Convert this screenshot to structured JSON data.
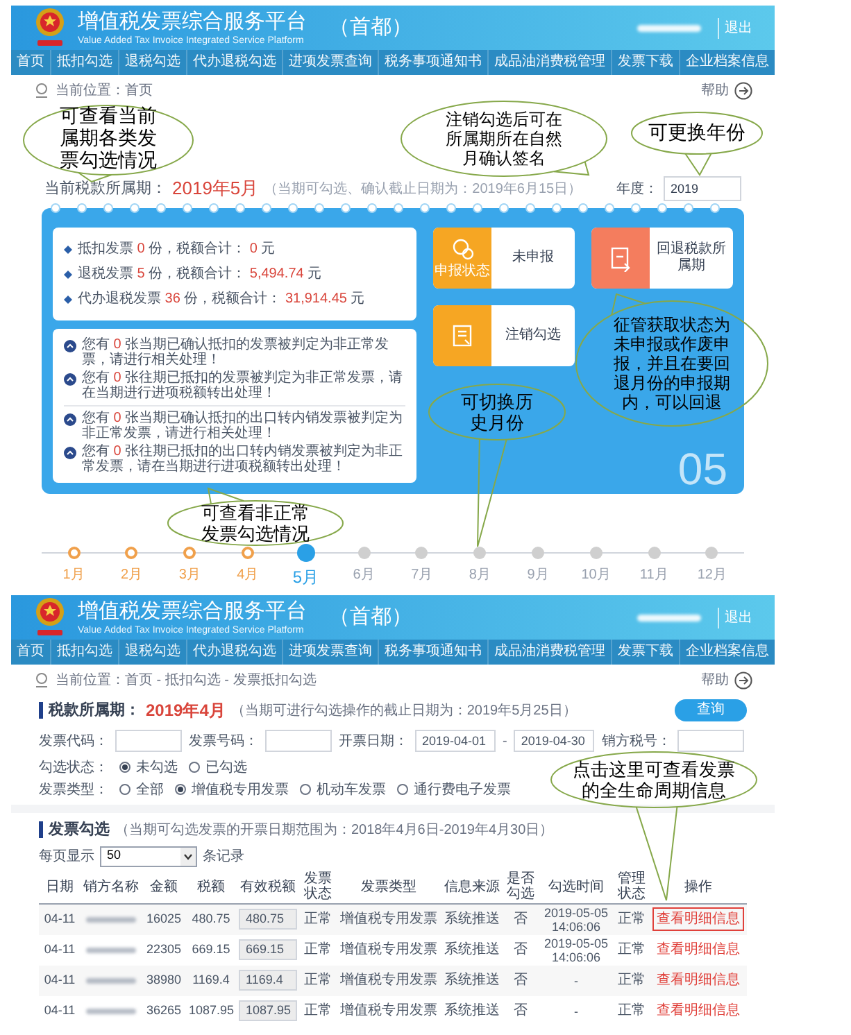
{
  "overview": {
    "header": {
      "title": "增值税发票综合服务平台",
      "subtitle": "Value Added Tax Invoice Integrated Service Platform",
      "region": "（首都）",
      "logout": "退出"
    },
    "nav": [
      "首页",
      "抵扣勾选",
      "退税勾选",
      "代办退税勾选",
      "进项发票查询",
      "税务事项通知书",
      "成品油消费税管理",
      "发票下载",
      "企业档案信息"
    ],
    "breadcrumb": "当前位置：首页",
    "help": "帮助",
    "period": {
      "label": "当前税款所属期：",
      "value": "2019年5月",
      "note": "（当期可勾选、确认截止日期为：2019年6月15日）"
    },
    "year": {
      "label": "年度：",
      "value": "2019"
    },
    "summary": [
      {
        "label": "抵扣发票",
        "count": "0",
        "mid": "份，税额合计：",
        "amount": "0",
        "unit": "元"
      },
      {
        "label": "退税发票",
        "count": "5",
        "mid": "份，税额合计：",
        "amount": "5,494.74",
        "unit": "元"
      },
      {
        "label": "代办退税发票",
        "count": "36",
        "mid": "份，税额合计：",
        "amount": "31,914.45",
        "unit": "元"
      }
    ],
    "tiles": [
      {
        "kind": "status",
        "icon_label": "申报状态",
        "label": "未申报"
      },
      {
        "kind": "rollback",
        "label": "回退税款所属期"
      },
      {
        "kind": "cancel",
        "label": "注销勾选"
      }
    ],
    "notice_groups": [
      [
        {
          "prefix": "您有",
          "count": "0",
          "text": "张当期已确认抵扣的发票被判定为非正常发票，请进行相关处理！"
        },
        {
          "prefix": "您有",
          "count": "0",
          "text": "张往期已抵扣的发票被判定为非正常发票，请在当期进行进项税额转出处理！"
        }
      ],
      [
        {
          "prefix": "您有",
          "count": "0",
          "text": "张当期已确认抵扣的出口转内销发票被判定为非正常发票，请进行相关处理！"
        },
        {
          "prefix": "您有",
          "count": "0",
          "text": "张往期已抵扣的出口转内销发票被判定为非正常发票，请在当期进行进项税额转出处理！"
        }
      ]
    ],
    "big_month": "05",
    "months": [
      {
        "label": "1月",
        "selected": false,
        "past": true
      },
      {
        "label": "2月",
        "selected": false,
        "past": true
      },
      {
        "label": "3月",
        "selected": false,
        "past": true
      },
      {
        "label": "4月",
        "selected": false,
        "past": true
      },
      {
        "label": "5月",
        "selected": true,
        "past": false
      },
      {
        "label": "6月",
        "selected": false,
        "past": false
      },
      {
        "label": "7月",
        "selected": false,
        "past": false
      },
      {
        "label": "8月",
        "selected": false,
        "past": false
      },
      {
        "label": "9月",
        "selected": false,
        "past": false
      },
      {
        "label": "10月",
        "selected": false,
        "past": false
      },
      {
        "label": "11月",
        "selected": false,
        "past": false
      },
      {
        "label": "12月",
        "selected": false,
        "past": false
      }
    ],
    "annotations": [
      {
        "text": "可查看当前属期各类发票勾选情况"
      },
      {
        "text": "注销勾选后可在所属期所在自然月确认签名"
      },
      {
        "text": "可更换年份"
      },
      {
        "text": "征管获取状态为未申报或作废申报，并且在要回退月份的申报期内，可以回退"
      },
      {
        "text": "可切换历史月份"
      },
      {
        "text": "可查看非正常发票勾选情况"
      }
    ]
  },
  "invoice_selection": {
    "header": {
      "title": "增值税发票综合服务平台",
      "subtitle": "Value Added Tax Invoice Integrated Service Platform",
      "region": "（首都）",
      "logout": "退出"
    },
    "nav": [
      "首页",
      "抵扣勾选",
      "退税勾选",
      "代办退税勾选",
      "进项发票查询",
      "税务事项通知书",
      "成品油消费税管理",
      "发票下载",
      "企业档案信息"
    ],
    "breadcrumb": "当前位置：首页 - 抵扣勾选 - 发票抵扣勾选",
    "help": "帮助",
    "period": {
      "label": "税款所属期：",
      "value": "2019年4月",
      "note": "（当期可进行勾选操作的截止日期为：2019年5月25日）"
    },
    "search_button": "查询",
    "filters": [
      {
        "kind": "text",
        "label": "发票代码："
      },
      {
        "kind": "text",
        "label": "发票号码："
      },
      {
        "kind": "range",
        "label": "开票日期：",
        "value": "2019-04-01",
        "separator": "-",
        "value_to": "2019-04-30"
      },
      {
        "kind": "text",
        "label": "销方税号："
      }
    ],
    "radio_groups": [
      {
        "label": "勾选状态：",
        "options": [
          {
            "label": "未勾选",
            "selected": true
          },
          {
            "label": "已勾选",
            "selected": false
          }
        ]
      },
      {
        "label": "发票类型：",
        "options": [
          {
            "label": "全部",
            "selected": false
          },
          {
            "label": "增值税专用发票",
            "selected": true
          },
          {
            "label": "机动车发票",
            "selected": false
          },
          {
            "label": "通行费电子发票",
            "selected": false
          }
        ]
      }
    ],
    "list_title": "发票勾选",
    "list_note": "（当期可勾选发票的开票日期范围为：2018年4月6日-2019年4月30日）",
    "page_size": {
      "label": "每页显示",
      "value": "50",
      "suffix": "条记录"
    },
    "table": {
      "columns": [
        "日期",
        "销方名称",
        "金额",
        "税额",
        "有效税额",
        "发票状态",
        "发票类型",
        "信息来源",
        "是否勾选",
        "勾选时间",
        "管理状态",
        "操作"
      ],
      "rows": [
        {
          "date": "04-11",
          "amount": "16025",
          "tax": "480.75",
          "valid_tax": "480.75",
          "invoice_status": "正常",
          "invoice_type": "增值税专用发票",
          "source": "系统推送",
          "selected_flag": "否",
          "time": "2019-05-05 14:06:06",
          "manage_status": "正常",
          "action": "查看明细信息",
          "highlighted": true
        },
        {
          "date": "04-11",
          "amount": "22305",
          "tax": "669.15",
          "valid_tax": "669.15",
          "invoice_status": "正常",
          "invoice_type": "增值税专用发票",
          "source": "系统推送",
          "selected_flag": "否",
          "time": "2019-05-05 14:06:06",
          "manage_status": "正常",
          "action": "查看明细信息",
          "highlighted": false
        },
        {
          "date": "04-11",
          "amount": "38980",
          "tax": "1169.4",
          "valid_tax": "1169.4",
          "invoice_status": "正常",
          "invoice_type": "增值税专用发票",
          "source": "系统推送",
          "selected_flag": "否",
          "time": "-",
          "manage_status": "正常",
          "action": "查看明细信息",
          "highlighted": false
        },
        {
          "date": "04-11",
          "amount": "36265",
          "tax": "1087.95",
          "valid_tax": "1087.95",
          "invoice_status": "正常",
          "invoice_type": "增值税专用发票",
          "source": "系统推送",
          "selected_flag": "否",
          "time": "-",
          "manage_status": "正常",
          "action": "查看明细信息",
          "highlighted": false
        }
      ]
    },
    "annotations": [
      {
        "text": "点击这里可查看发票的全生命周期信息"
      }
    ]
  }
}
